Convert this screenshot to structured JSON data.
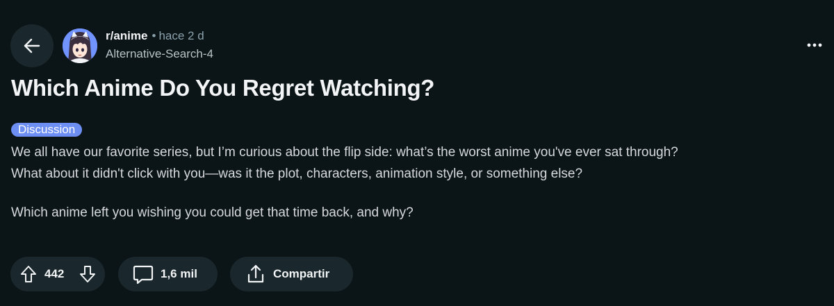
{
  "post": {
    "subreddit": "r/anime",
    "separator": "•",
    "time": "hace 2 d",
    "author": "Alternative-Search-4",
    "title": "Which Anime Do You Regret Watching?",
    "flair": "Discussion",
    "body": [
      "We all have our favorite series, but I’m curious about the flip side: what’s the worst anime you've ever sat through?",
      "What about it didn't click with you—was it the plot, characters, animation style, or something else?",
      "Which anime left you wishing you could get that time back, and why?"
    ]
  },
  "actions": {
    "votes": "442",
    "comments": "1,6 mil",
    "share_label": "Compartir"
  },
  "icons": {
    "back": "arrow-left-icon",
    "overflow": "more-horizontal-icon",
    "upvote": "upvote-arrow-icon",
    "downvote": "downvote-arrow-icon",
    "comment": "comment-bubble-icon",
    "share": "share-icon"
  },
  "colors": {
    "background": "#0b1416",
    "pill_background": "#1a282d",
    "flair_background": "#6d8ef3",
    "avatar_background": "#7193ff",
    "muted_text": "#8ba2ad"
  }
}
